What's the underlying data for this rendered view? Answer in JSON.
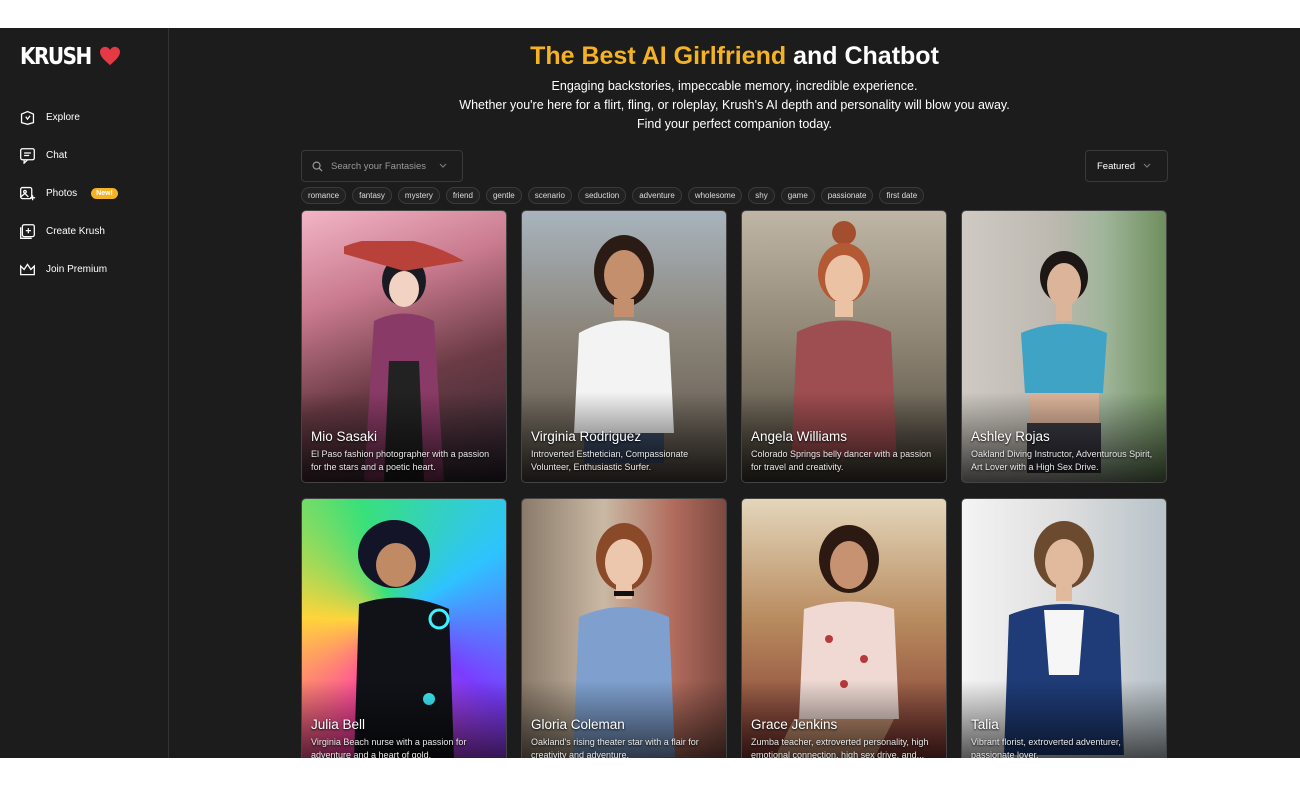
{
  "brand": {
    "name": "KRUSH",
    "heart_color": "#e63946"
  },
  "sidebar": {
    "items": [
      {
        "label": "Explore",
        "icon": "explore-icon"
      },
      {
        "label": "Chat",
        "icon": "chat-icon"
      },
      {
        "label": "Photos",
        "icon": "photos-icon",
        "badge": "New!"
      },
      {
        "label": "Create Krush",
        "icon": "create-icon"
      },
      {
        "label": "Join Premium",
        "icon": "crown-icon"
      }
    ]
  },
  "hero": {
    "title_highlight": "The Best AI Girlfriend",
    "title_rest": " and Chatbot",
    "line1": "Engaging backstories, impeccable memory, incredible experience.",
    "line2": "Whether you're here for a flirt, fling, or roleplay, Krush's AI depth and personality will blow you away.",
    "line3": "Find your perfect companion today."
  },
  "search": {
    "placeholder": "Search your Fantasies"
  },
  "sort": {
    "label": "Featured"
  },
  "tags": [
    "romance",
    "fantasy",
    "mystery",
    "friend",
    "gentle",
    "scenario",
    "seduction",
    "adventure",
    "wholesome",
    "shy",
    "game",
    "passionate",
    "first date"
  ],
  "cards": [
    {
      "name": "Mio Sasaki",
      "desc": "El Paso fashion photographer with a passion for the stars and a poetic heart."
    },
    {
      "name": "Virginia Rodriguez",
      "desc": "Introverted Esthetician, Compassionate Volunteer, Enthusiastic Surfer."
    },
    {
      "name": "Angela Williams",
      "desc": "Colorado Springs belly dancer with a passion for travel and creativity."
    },
    {
      "name": "Ashley Rojas",
      "desc": "Oakland Diving Instructor, Adventurous Spirit, Art Lover with a High Sex Drive."
    },
    {
      "name": "Julia Bell",
      "desc": "Virginia Beach nurse with a passion for adventure and a heart of gold."
    },
    {
      "name": "Gloria Coleman",
      "desc": "Oakland's rising theater star with a flair for creativity and adventure."
    },
    {
      "name": "Grace Jenkins",
      "desc": "Zumba teacher, extroverted personality, high emotional connection, high sex drive, and..."
    },
    {
      "name": "Talia",
      "desc": "Vibrant florist, extroverted adventurer, passionate lover."
    }
  ],
  "colors": {
    "accent": "#f5b323",
    "background": "#1c1c1c"
  }
}
